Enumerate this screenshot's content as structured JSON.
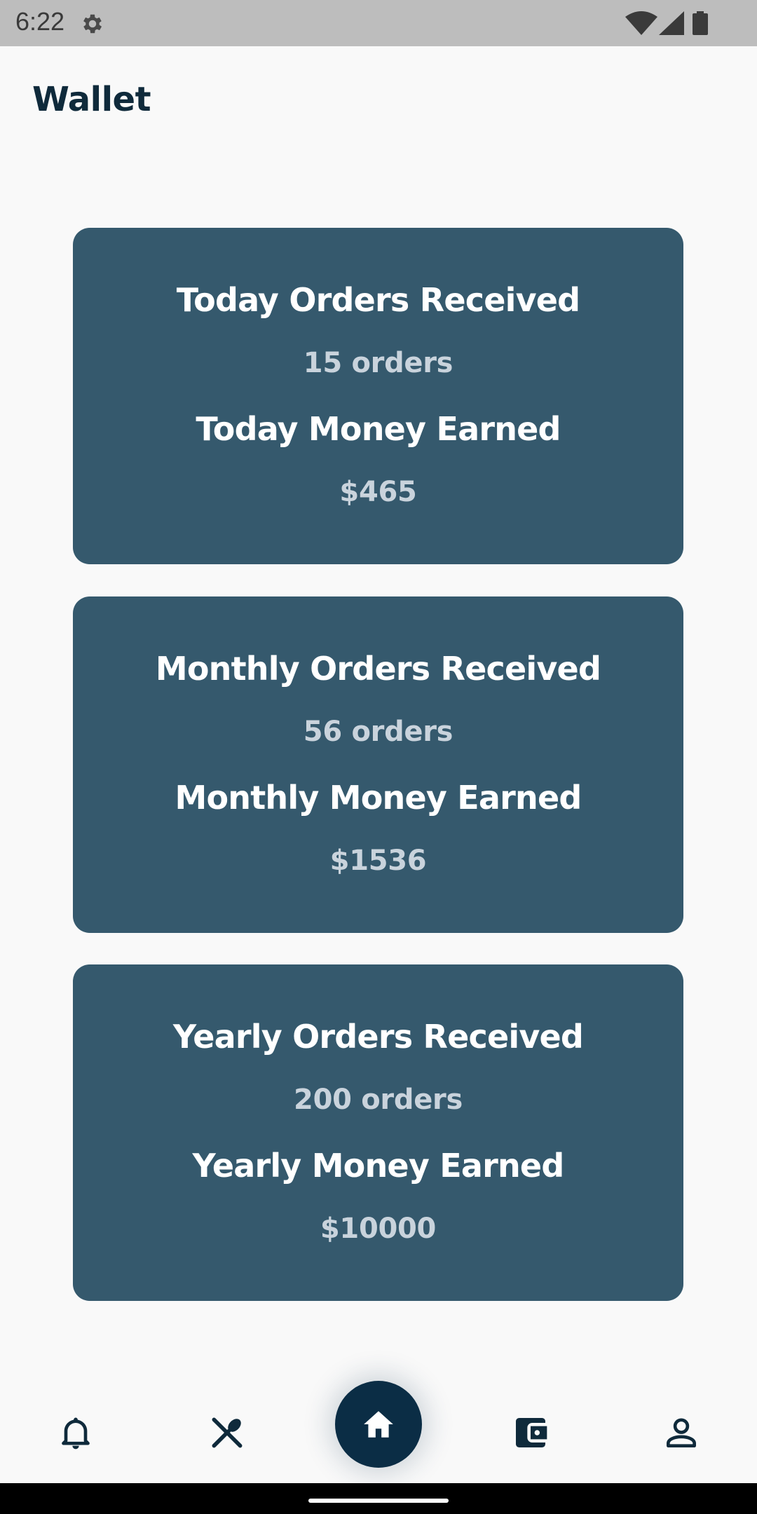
{
  "status_bar": {
    "time": "6:22"
  },
  "header": {
    "title": "Wallet"
  },
  "cards": [
    {
      "orders_heading": "Today Orders Received",
      "orders_value": "15 orders",
      "money_heading": "Today Money Earned",
      "money_value": "$465"
    },
    {
      "orders_heading": "Monthly Orders Received",
      "orders_value": "56 orders",
      "money_heading": "Monthly Money Earned",
      "money_value": "$1536"
    },
    {
      "orders_heading": "Yearly Orders Received",
      "orders_value": "200 orders",
      "money_heading": "Yearly Money Earned",
      "money_value": "$10000"
    }
  ],
  "bottom_nav": {
    "items": [
      {
        "icon": "bell-icon"
      },
      {
        "icon": "utensils-icon"
      },
      {
        "icon": "home-icon",
        "active": true
      },
      {
        "icon": "wallet-icon"
      },
      {
        "icon": "person-icon"
      }
    ]
  },
  "colors": {
    "background": "#f9f9f9",
    "card": "#35596d",
    "card_heading": "#ffffff",
    "card_value": "#c9d3dc",
    "title": "#0f2a3b",
    "fab": "#0b2d45"
  }
}
